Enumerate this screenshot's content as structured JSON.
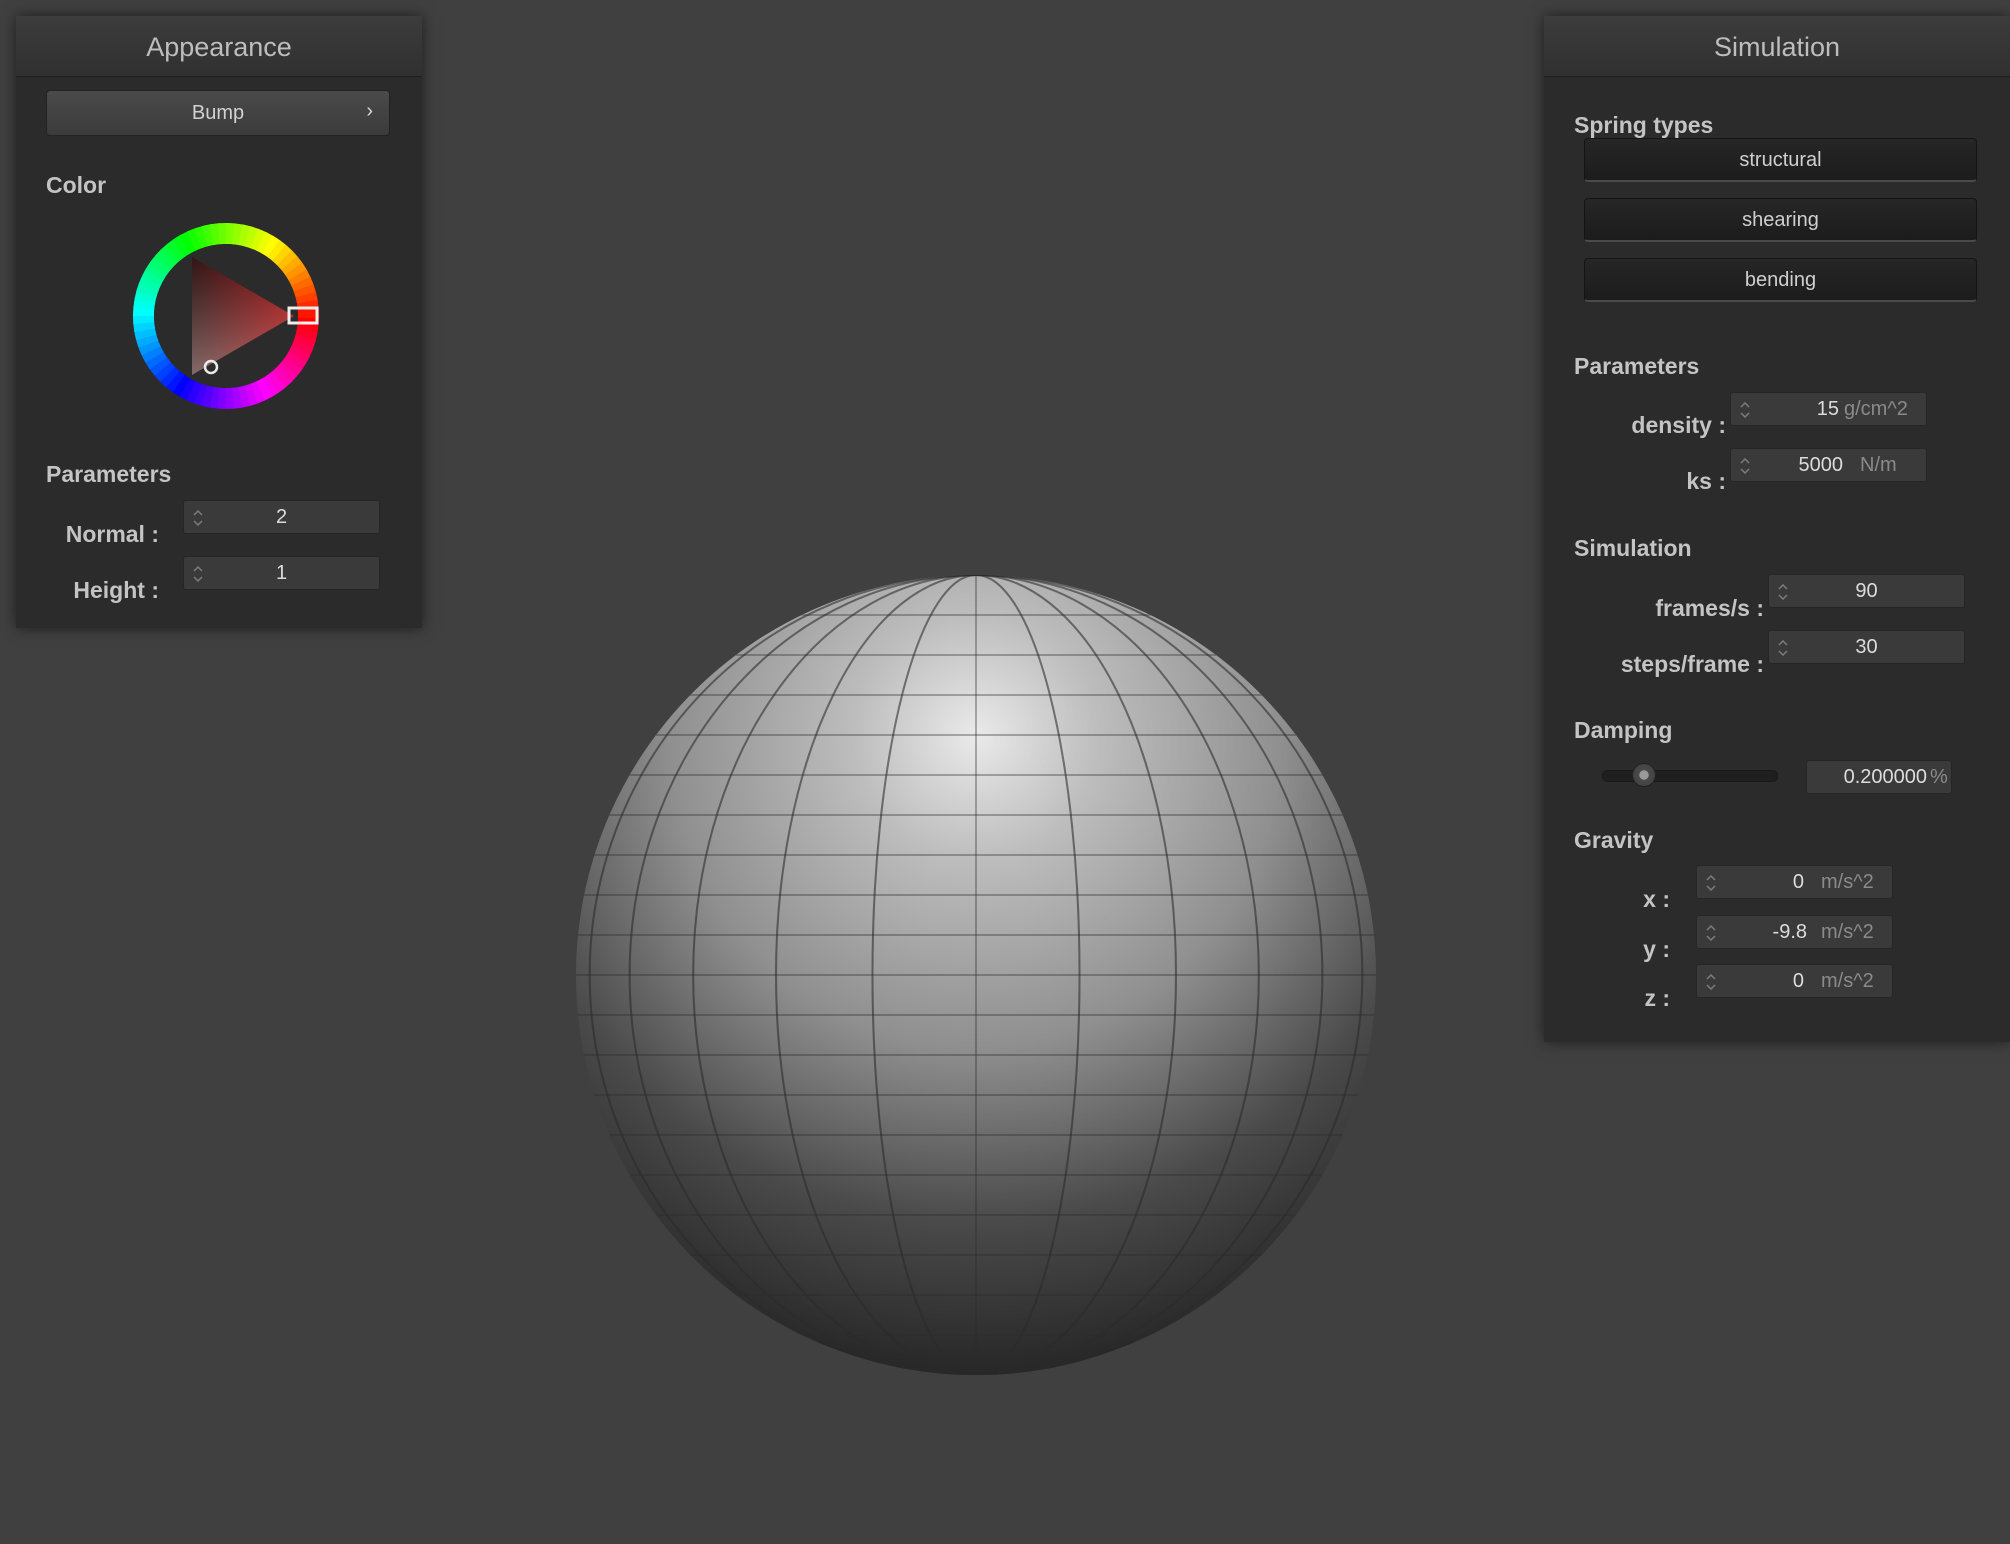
{
  "appearance": {
    "title": "Appearance",
    "mode_button": "Bump",
    "color_label": "Color",
    "parameters_label": "Parameters",
    "normal_label": "Normal :",
    "normal_value": "2",
    "height_label": "Height :",
    "height_value": "1",
    "selected_color": "#e23030"
  },
  "simulation": {
    "title": "Simulation",
    "spring_types_label": "Spring types",
    "spring_types": [
      "structural",
      "shearing",
      "bending"
    ],
    "parameters_label": "Parameters",
    "density_label": "density :",
    "density_value": "15",
    "density_unit": "g/cm^2",
    "ks_label": "ks :",
    "ks_value": "5000",
    "ks_unit": "N/m",
    "simulation_label": "Simulation",
    "fps_label": "frames/s :",
    "fps_value": "90",
    "steps_label": "steps/frame :",
    "steps_value": "30",
    "damping_label": "Damping",
    "damping_value": "0.200000",
    "damping_unit": "%",
    "damping_fraction": 0.2,
    "gravity_label": "Gravity",
    "gx_label": "x :",
    "gx_value": "0",
    "gy_label": "y :",
    "gy_value": "-9.8",
    "gz_label": "z :",
    "gz_value": "0",
    "gravity_unit": "m/s^2"
  },
  "icons": {
    "spin": "spinner-arrows-icon",
    "chevron": "chevron-right-icon"
  }
}
